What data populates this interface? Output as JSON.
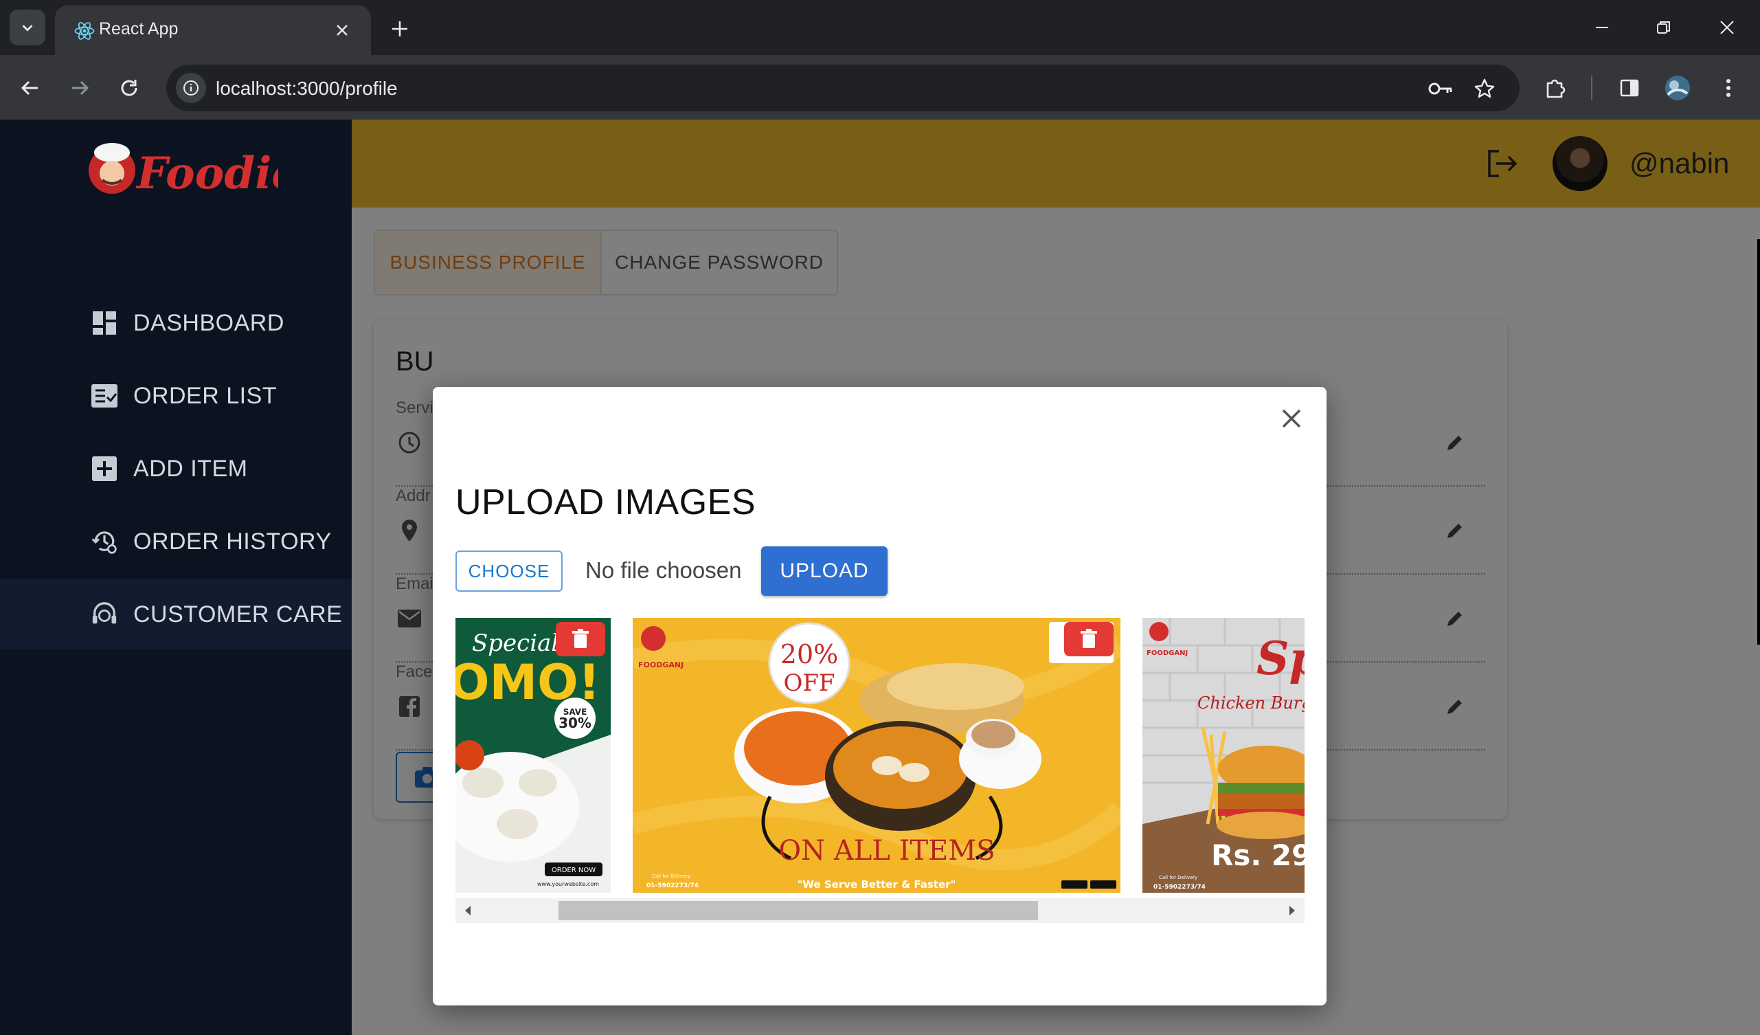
{
  "browser": {
    "tab_title": "React App",
    "url": "localhost:3000/profile"
  },
  "app": {
    "brand": "Foodie",
    "sidebar": {
      "items": [
        {
          "label": "DASHBOARD",
          "icon": "dashboard-icon"
        },
        {
          "label": "ORDER LIST",
          "icon": "order-list-icon"
        },
        {
          "label": "ADD ITEM",
          "icon": "add-box-icon"
        },
        {
          "label": "ORDER HISTORY",
          "icon": "history-settings-icon"
        },
        {
          "label": "CUSTOMER CARE",
          "icon": "support-agent-icon",
          "active": true
        }
      ]
    },
    "header": {
      "username": "@nabin"
    },
    "profile_tabs": {
      "business_profile": "BUSINESS PROFILE",
      "change_password": "CHANGE PASSWORD",
      "active": "business_profile"
    },
    "card": {
      "title": "BU",
      "fields": [
        {
          "label": "Servi",
          "icon": "clock-icon"
        },
        {
          "label": "Addr",
          "icon": "location-pin-icon"
        },
        {
          "label": "Emai",
          "icon": "email-icon"
        },
        {
          "label": "Face",
          "icon": "facebook-icon"
        }
      ]
    }
  },
  "modal": {
    "title": "UPLOAD IMAGES",
    "choose_label": "CHOOSE",
    "file_status": "No file choosen",
    "upload_label": "UPLOAD",
    "images": [
      {
        "title": "Special",
        "headline": "OMO!",
        "badge_top": "SAVE",
        "badge_value": "30%",
        "cta": "ORDER NOW",
        "website": "www.yourwebsite.com"
      },
      {
        "brand": "FOODGANJ",
        "discount": "20%",
        "discount_sub": "OFF",
        "headline": "ON ALL ITEMS",
        "tagline": "\"We Serve Better & Faster\"",
        "call_label": "Call for Delivery",
        "phone": "01-5902273/74"
      },
      {
        "brand": "FOODGANJ",
        "title": "Spe",
        "subtitle": "Chicken Burger",
        "price": "Rs. 29",
        "call_label": "Call for Delivery",
        "phone": "01-5902273/74"
      }
    ],
    "scroll_position": 0.07,
    "scroll_visible_fraction": 0.6
  },
  "colors": {
    "accent_yellow": "#f3bf2a",
    "sidebar_bg": "#0b1321",
    "primary_blue": "#2f6fd1",
    "delete_red": "#e53935",
    "active_tab_orange": "#e07a1f"
  }
}
